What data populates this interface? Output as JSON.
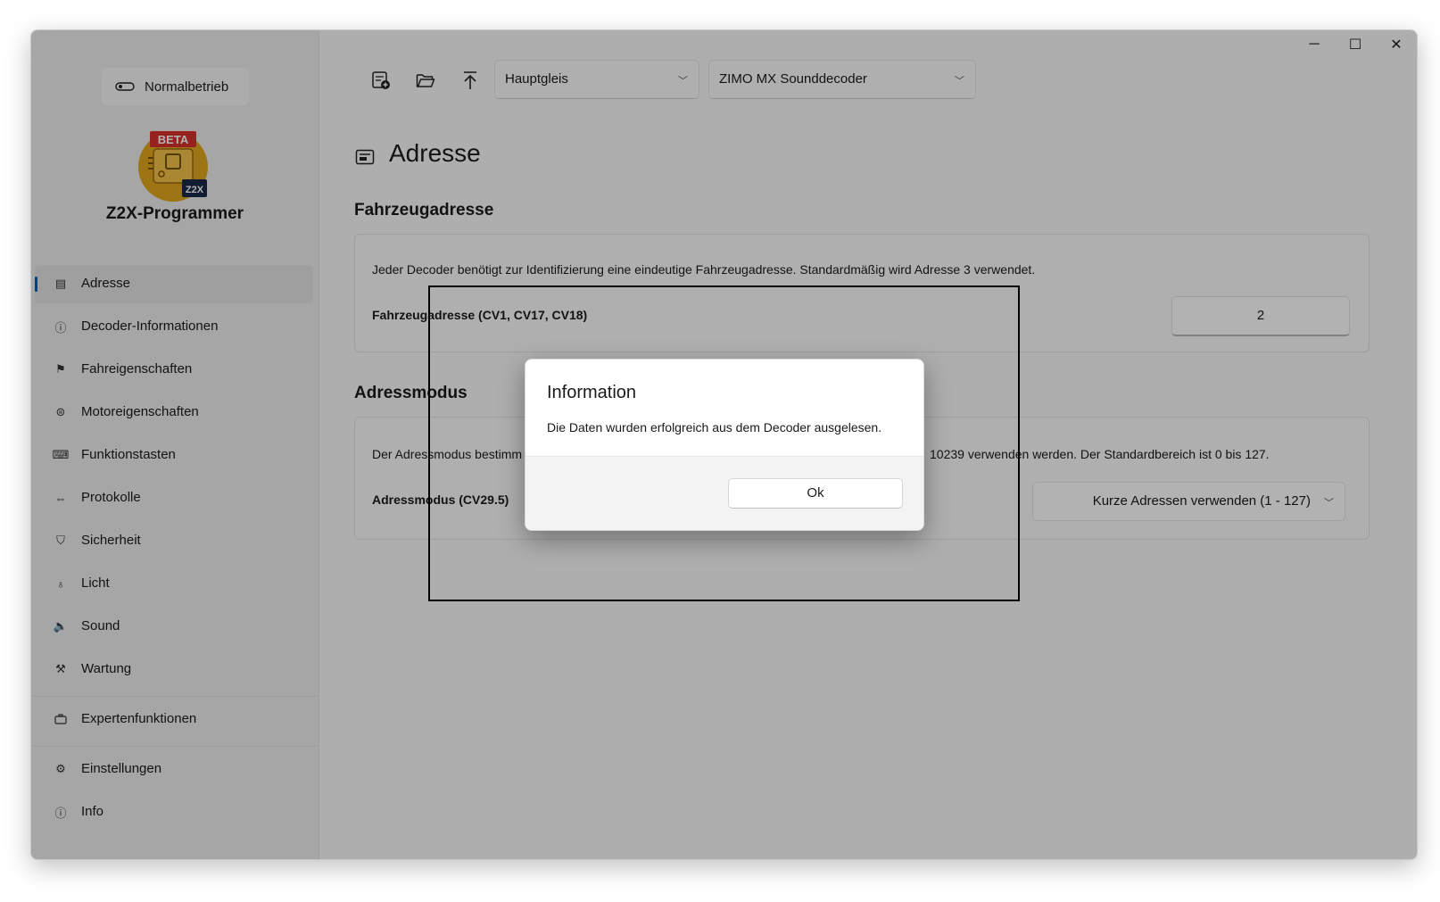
{
  "window": {
    "controls": {
      "minimize": "─",
      "maximize": "☐",
      "close": "✕"
    }
  },
  "sidebar": {
    "mode_label": "Normalbetrieb",
    "logo_badge": "BETA",
    "logo_mark": "Z2X",
    "app_title": "Z2X-Programmer",
    "items": [
      {
        "label": "Adresse",
        "icon": "address-card-icon",
        "glyph": "▤"
      },
      {
        "label": "Decoder-Informationen",
        "icon": "info-icon",
        "glyph": "ⓘ"
      },
      {
        "label": "Fahreigenschaften",
        "icon": "drive-icon",
        "glyph": "⚑"
      },
      {
        "label": "Motoreigenschaften",
        "icon": "motor-icon",
        "glyph": "⊜"
      },
      {
        "label": "Funktionstasten",
        "icon": "keys-icon",
        "glyph": "⌨"
      },
      {
        "label": "Protokolle",
        "icon": "protocol-icon",
        "glyph": "⇔"
      },
      {
        "label": "Sicherheit",
        "icon": "shield-icon",
        "glyph": "⛉"
      },
      {
        "label": "Licht",
        "icon": "lightbulb-icon",
        "glyph": "♁"
      },
      {
        "label": "Sound",
        "icon": "speaker-icon",
        "glyph": "🔈"
      },
      {
        "label": "Wartung",
        "icon": "tools-icon",
        "glyph": "⚒"
      }
    ],
    "expert_label": "Expertenfunktionen",
    "settings_label": "Einstellungen",
    "info_label": "Info"
  },
  "toolbar": {
    "track_value": "Hauptgleis",
    "decoder_value": "ZIMO MX Sounddecoder"
  },
  "page": {
    "title": "Adresse",
    "vehicle_section": {
      "title": "Fahrzeugadresse",
      "description": "Jeder Decoder benötigt zur Identifizierung eine eindeutige Fahrzeugadresse. Standardmäßig wird Adresse 3 verwendet.",
      "label": "Fahrzeugadresse (CV1, CV17, CV18)",
      "value": "2"
    },
    "mode_section": {
      "title": "Adressmodus",
      "description_start": "Der Adressmodus bestimm",
      "description_end": "10239 verwenden werden. Der Standardbereich ist 0 bis 127.",
      "label": "Adressmodus (CV29.5)",
      "value": "Kurze Adressen verwenden (1 - 127)"
    }
  },
  "dialog": {
    "title": "Information",
    "message": "Die Daten wurden erfolgreich aus dem Decoder ausgelesen.",
    "ok_label": "Ok"
  }
}
